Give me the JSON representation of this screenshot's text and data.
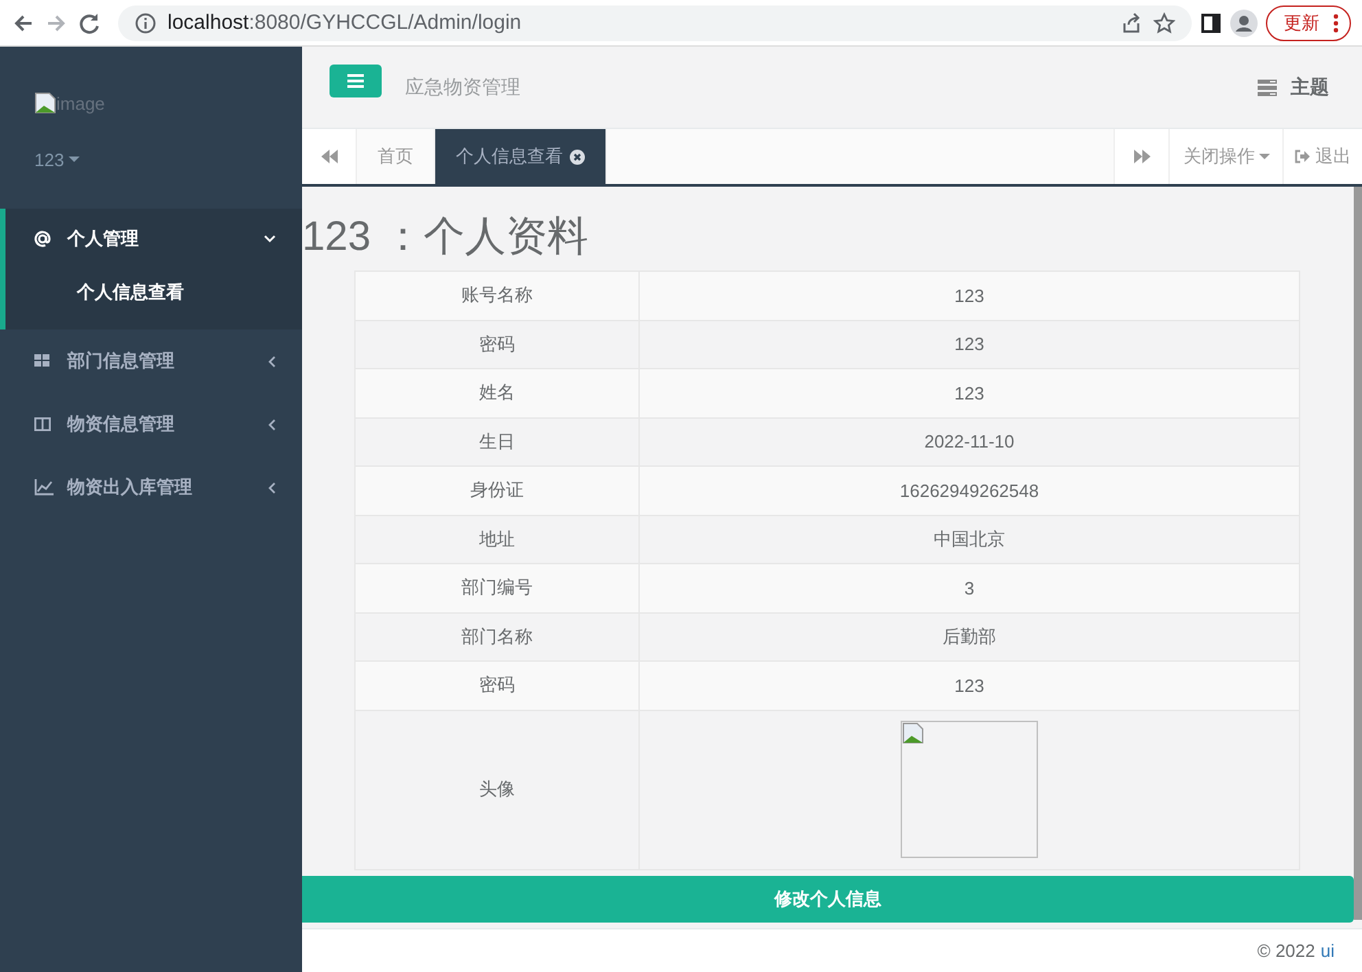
{
  "browser": {
    "url_host": "localhost",
    "url_path": ":8080/GYHCCGL/Admin/login",
    "update_button": "更新"
  },
  "sidebar": {
    "logo_alt": "image",
    "user": "123",
    "menu": [
      {
        "label": "个人管理",
        "expanded": true,
        "children": [
          {
            "label": "个人信息查看",
            "selected": true
          }
        ]
      },
      {
        "label": "部门信息管理",
        "expanded": false
      },
      {
        "label": "物资信息管理",
        "expanded": false
      },
      {
        "label": "物资出入库管理",
        "expanded": false
      }
    ]
  },
  "header": {
    "title": "应急物资管理",
    "theme": "主题"
  },
  "tabs": {
    "items": [
      {
        "label": "首页",
        "selected": false,
        "closable": false
      },
      {
        "label": "个人信息查看",
        "selected": true,
        "closable": true
      }
    ],
    "close_menu": "关闭操作",
    "logout": "退出"
  },
  "profile": {
    "heading": "123 ：个人资料",
    "rows": [
      {
        "label": "账号名称",
        "value": "123"
      },
      {
        "label": "密码",
        "value": "123"
      },
      {
        "label": "姓名",
        "value": "123"
      },
      {
        "label": "生日",
        "value": "2022-11-10"
      },
      {
        "label": "身份证",
        "value": "16262949262548"
      },
      {
        "label": "地址",
        "value": "中国北京"
      },
      {
        "label": "部门编号",
        "value": "3"
      },
      {
        "label": "部门名称",
        "value": "后勤部"
      },
      {
        "label": "密码",
        "value": "123"
      },
      {
        "label": "头像",
        "kind": "image"
      }
    ],
    "edit_button": "修改个人信息"
  },
  "footer": {
    "copyright": "© 2022",
    "link": "ui"
  }
}
